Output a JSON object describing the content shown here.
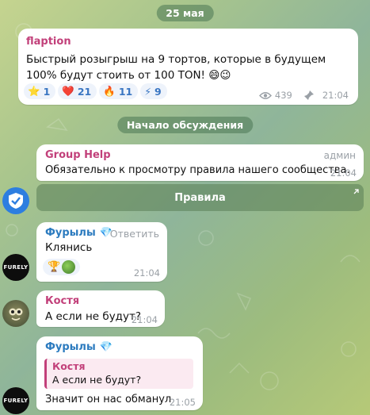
{
  "date_chip": "25 мая",
  "post": {
    "sender": "flaption",
    "text": "Быстрый розыгрыш на 9 тортов, которые в будущем 100% будут стоить от 100 TON! 😄😉",
    "reactions": [
      {
        "icon": "star-icon",
        "emoji": "⭐",
        "count": "1"
      },
      {
        "icon": "heart-icon",
        "emoji": "❤️",
        "count": "21"
      },
      {
        "icon": "fire-icon",
        "emoji": "🔥",
        "count": "11"
      },
      {
        "icon": "lightning-icon",
        "emoji": "⚡",
        "count": "9"
      }
    ],
    "views": "439",
    "time": "21:04"
  },
  "discussion_chip": "Начало обсуждения",
  "messages": {
    "group_help": {
      "sender": "Group Help",
      "role": "админ",
      "text": "Обязательно к просмотру правила нашего сообщества.",
      "time": "21:04",
      "button": "Правила"
    },
    "msg1": {
      "sender": "Фурылы",
      "sender_badge": "💎",
      "reply_link": "Ответить",
      "text": "Клянись",
      "time": "21:04"
    },
    "msg2": {
      "sender": "Костя",
      "text": "А если не будут?",
      "time": "21:04"
    },
    "msg3": {
      "sender": "Фурылы",
      "sender_badge": "💎",
      "quote_sender": "Костя",
      "quote_text": "А если не будут?",
      "text": "Значит он нас обманул",
      "time": "21:05"
    }
  },
  "avatar_label": "FURELY",
  "colors": {
    "accent_blue": "#3a76c2",
    "name_pink": "#c2407a",
    "name_blue": "#2c7bbf"
  }
}
